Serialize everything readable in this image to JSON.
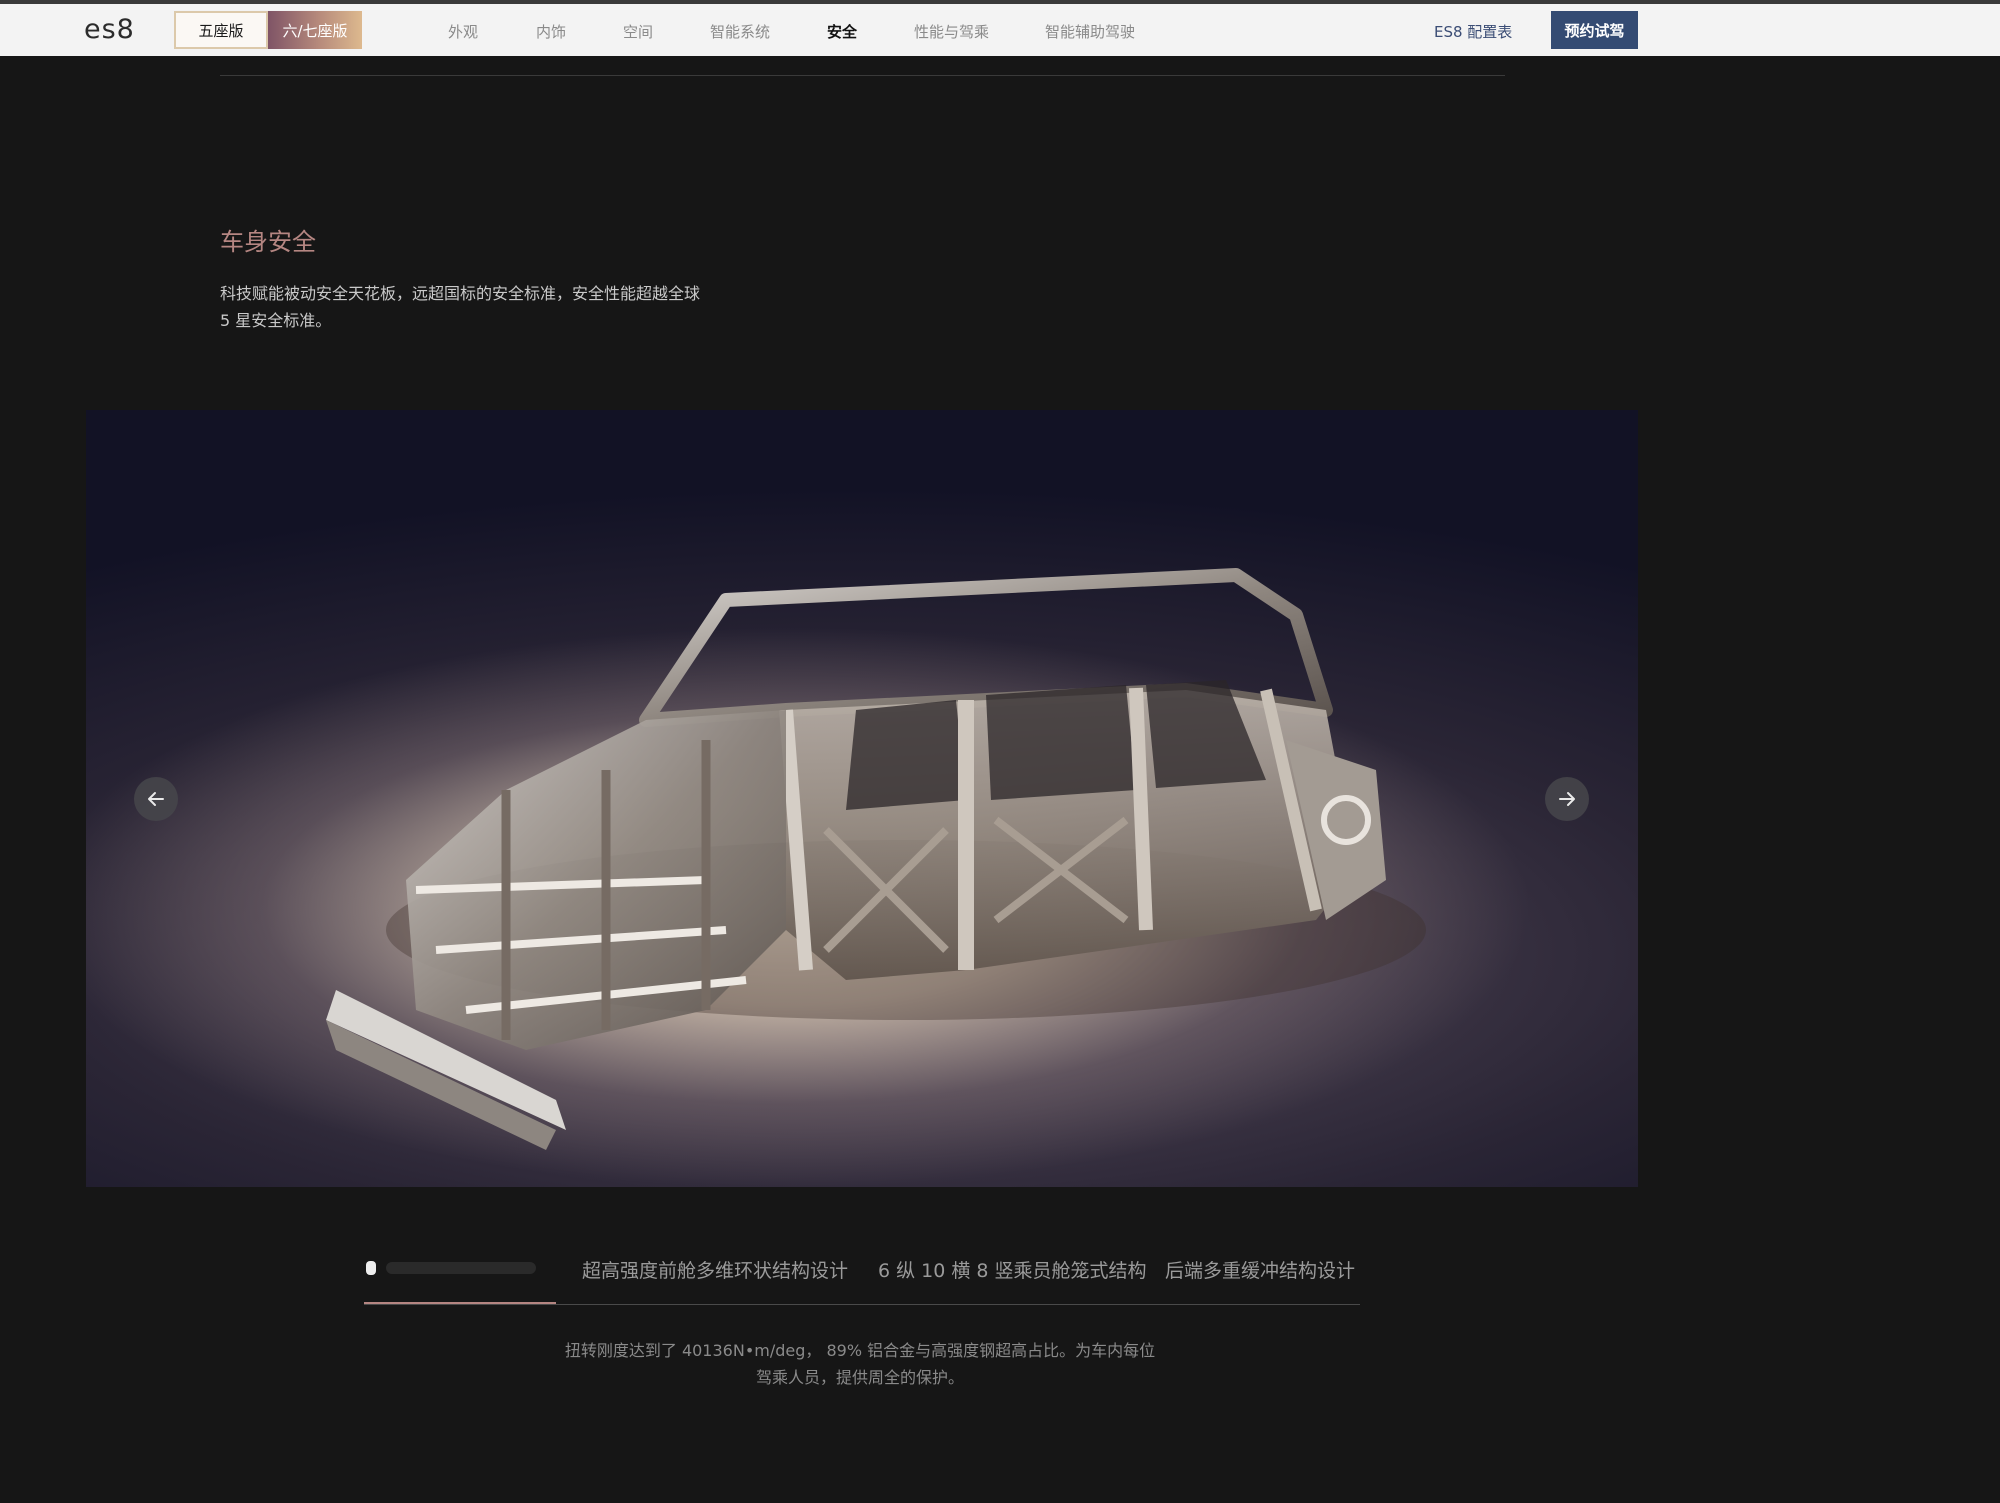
{
  "header": {
    "logo": "es8",
    "seat_versions": [
      "五座版",
      "六/七座版"
    ],
    "nav_items": [
      "外观",
      "内饰",
      "空间",
      "智能系统",
      "安全",
      "性能与驾乘",
      "智能辅助驾驶"
    ],
    "active_nav": "安全",
    "config_link": "ES8 配置表",
    "cta_button": "预约试驾"
  },
  "section": {
    "title": "车身安全",
    "description": "科技赋能被动安全天花板，远超国标的安全标准，安全性能超越全球 5 星安全标准。"
  },
  "carousel": {
    "image_subject": "car-body-frame",
    "prev_icon": "arrow-left-icon",
    "next_icon": "arrow-right-icon"
  },
  "tabs": {
    "items": [
      "",
      "超高强度前舱多维环状结构设计",
      "6 纵 10 横 8 竖乘员舱笼式结构",
      "后端多重缓冲结构设计"
    ],
    "caption": "扭转刚度达到了 40136N•m/deg， 89% 铝合金与高强度钢超高占比。为车内每位驾乘人员，提供周全的保护。"
  },
  "colors": {
    "accent": "#b58682",
    "cta": "#344b73",
    "background": "#161616"
  }
}
